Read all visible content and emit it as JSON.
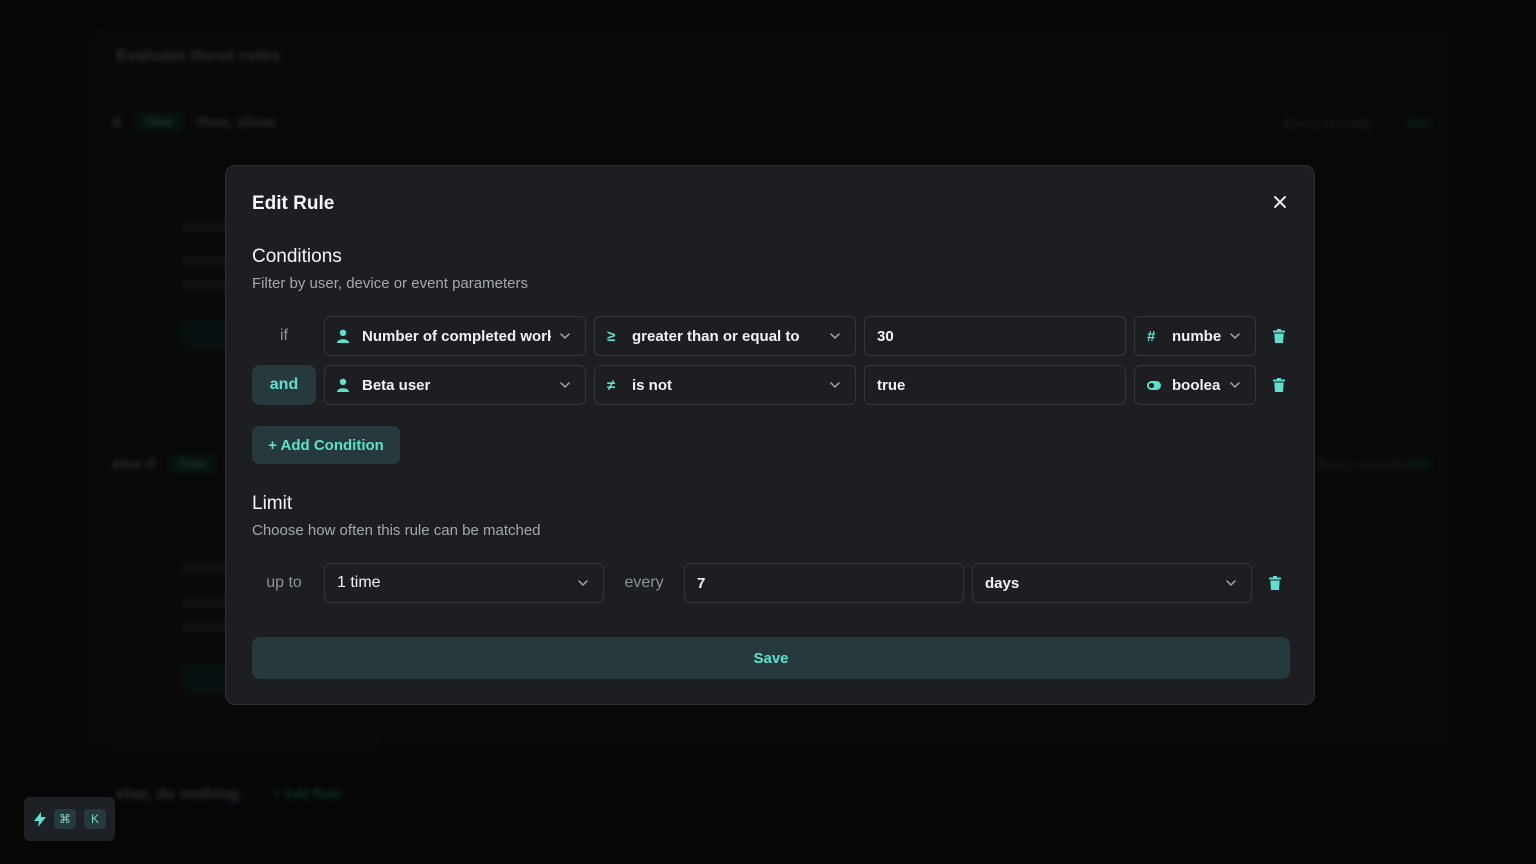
{
  "background": {
    "title": "Evaluate these rules",
    "rule1": {
      "keyword": "if",
      "badge": "Time",
      "label": "then, show",
      "right_text": "Every recently",
      "right_action": "Edit"
    },
    "rule2": {
      "keyword": "else if",
      "badge": "Time",
      "right_text": "Every recently",
      "right_action": "Edit"
    },
    "footer": {
      "text": "else, do nothing.",
      "add_rule": "+ Add Rule"
    }
  },
  "modal": {
    "title": "Edit Rule",
    "close_icon": "close-icon",
    "conditions": {
      "title": "Conditions",
      "subtitle": "Filter by user, device or event parameters",
      "rows": [
        {
          "keyword": "if",
          "property": {
            "icon": "user-icon",
            "label": "Number of completed workouts"
          },
          "operator": {
            "icon": "greater-equal-icon",
            "symbol": "≥",
            "label": "greater than or equal to"
          },
          "value": "30",
          "type": {
            "icon": "hash-icon",
            "symbol": "#",
            "label": "number"
          }
        },
        {
          "keyword": "and",
          "property": {
            "icon": "user-icon",
            "label": "Beta user"
          },
          "operator": {
            "icon": "not-equal-icon",
            "symbol": "≠",
            "label": "is not"
          },
          "value": "true",
          "type": {
            "icon": "toggle-icon",
            "label": "boolean"
          }
        }
      ],
      "add_button": "+ Add Condition"
    },
    "limit": {
      "title": "Limit",
      "subtitle": "Choose how often this rule can be matched",
      "prefix": "up to",
      "count": "1 time",
      "middle": "every",
      "interval": "7",
      "unit": "days"
    },
    "save_button": "Save"
  },
  "command_bar": {
    "cmd_key": "⌘",
    "k_key": "K"
  },
  "colors": {
    "accent": "#5fe0cf",
    "pill_bg": "#26393c",
    "modal_bg": "#1c1e22",
    "border": "#33363c"
  }
}
